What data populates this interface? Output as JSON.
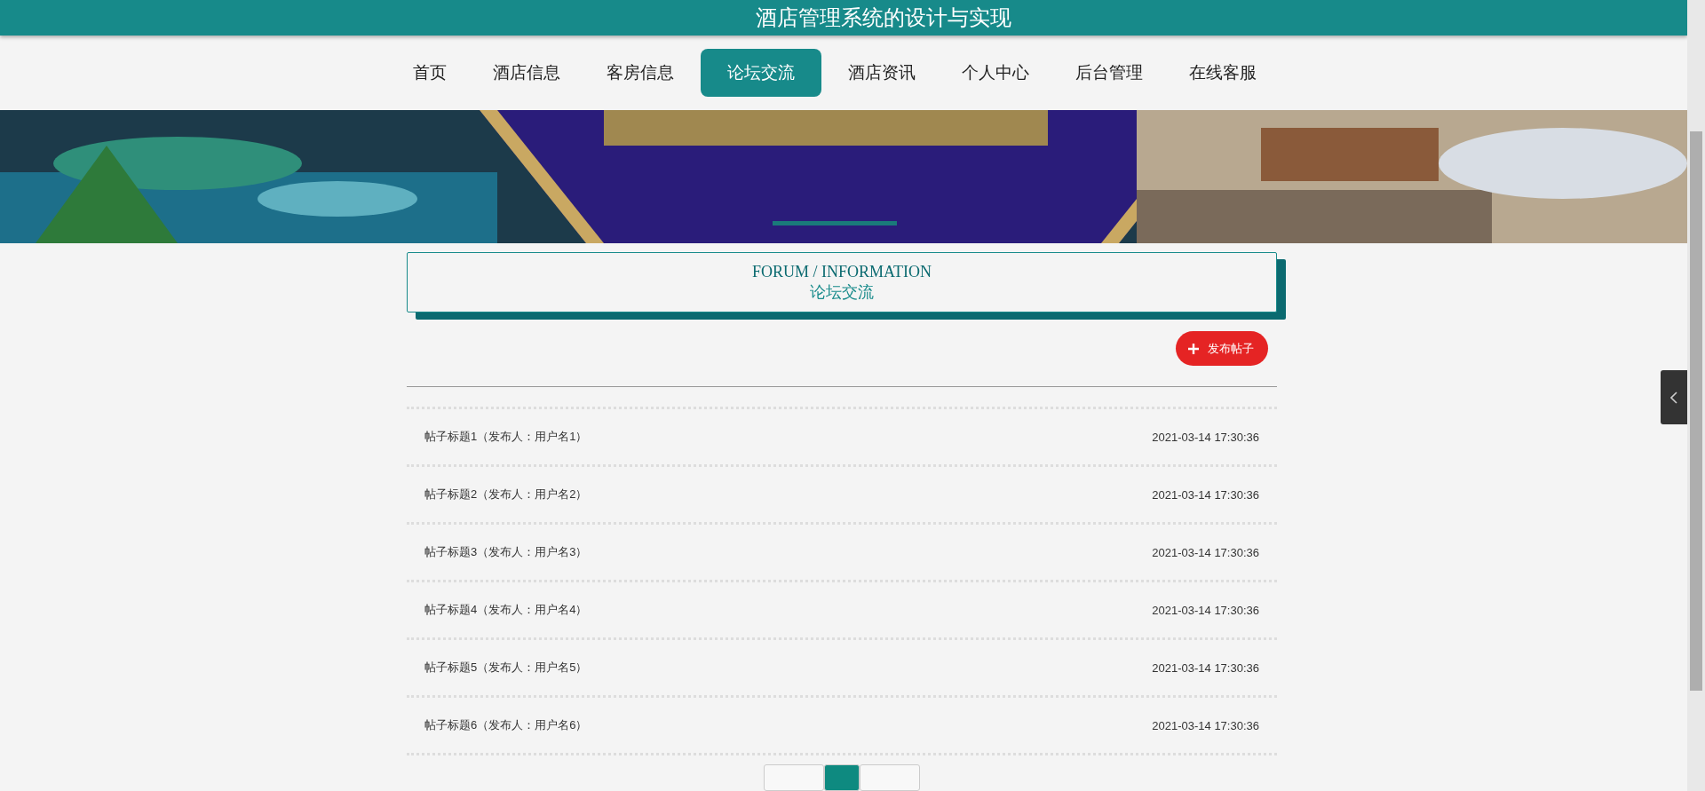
{
  "header": {
    "title": "酒店管理系统的设计与实现"
  },
  "nav": [
    {
      "label": "首页",
      "selected": false
    },
    {
      "label": "酒店信息",
      "selected": false
    },
    {
      "label": "客房信息",
      "selected": false
    },
    {
      "label": "论坛交流",
      "selected": true
    },
    {
      "label": "酒店资讯",
      "selected": false
    },
    {
      "label": "个人中心",
      "selected": false
    },
    {
      "label": "后台管理",
      "selected": false
    },
    {
      "label": "在线客服",
      "selected": false
    }
  ],
  "section_title": {
    "english": "FORUM / INFORMATION",
    "chinese": "论坛交流"
  },
  "publish_button": {
    "label": "发布帖子"
  },
  "posts": [
    {
      "title": "帖子标题1（发布人：用户名1）",
      "time": "2021-03-14 17:30:36"
    },
    {
      "title": "帖子标题2（发布人：用户名2）",
      "time": "2021-03-14 17:30:36"
    },
    {
      "title": "帖子标题3（发布人：用户名3）",
      "time": "2021-03-14 17:30:36"
    },
    {
      "title": "帖子标题4（发布人：用户名4）",
      "time": "2021-03-14 17:30:36"
    },
    {
      "title": "帖子标题5（发布人：用户名5）",
      "time": "2021-03-14 17:30:36"
    },
    {
      "title": "帖子标题6（发布人：用户名6）",
      "time": "2021-03-14 17:30:36"
    }
  ],
  "pagination": [
    {
      "kind": "prev",
      "selected": false
    },
    {
      "kind": "page",
      "selected": true
    },
    {
      "kind": "next",
      "selected": false
    }
  ]
}
